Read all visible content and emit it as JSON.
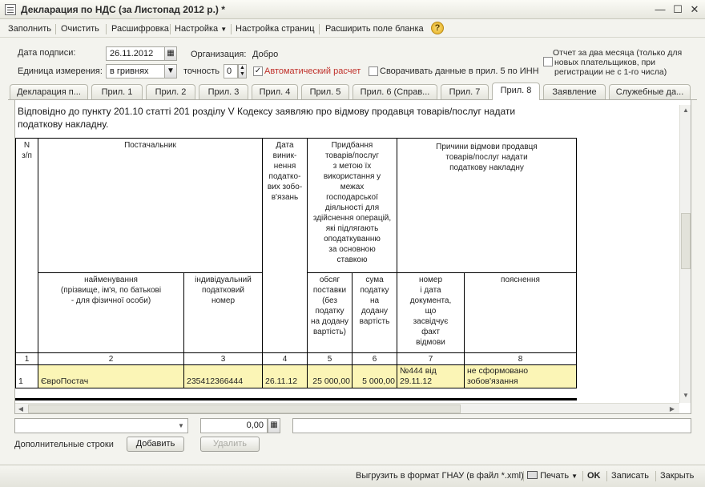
{
  "window": {
    "title": "Декларация по НДС (за Листопад 2012 р.) *"
  },
  "toolbar": {
    "fill": "Заполнить",
    "clear": "Очистить",
    "decode": "Расшифровка",
    "settings": "Настройка",
    "page_settings": "Настройка страниц",
    "expand_field": "Расширить поле бланка",
    "help": "?"
  },
  "form": {
    "sign_date_label": "Дата подписи:",
    "sign_date_value": "26.11.2012",
    "organization_label": "Организация:",
    "organization_value": "Добро",
    "unit_label": "Единица измерения:",
    "unit_value": "в гривнях",
    "precision_label": "точность",
    "precision_value": "0",
    "auto_calc_label": "Автоматический расчет",
    "auto_calc_checked": true,
    "collapse_label": "Сворачивать данные в прил. 5 по ИНН",
    "collapse_checked": false,
    "two_month_label_1": "Отчет за два месяца (только для",
    "two_month_label_2": "новых плательщиков, при",
    "two_month_label_3": "регистрации не с 1-го числа)",
    "two_month_checked": false
  },
  "tabs": [
    {
      "label": "Декларация п..."
    },
    {
      "label": "Прил. 1"
    },
    {
      "label": "Прил. 2"
    },
    {
      "label": "Прил. 3"
    },
    {
      "label": "Прил. 4"
    },
    {
      "label": "Прил. 5"
    },
    {
      "label": "Прил. 6 (Справ..."
    },
    {
      "label": "Прил. 7"
    },
    {
      "label": "Прил. 8"
    },
    {
      "label": "Заявление"
    },
    {
      "label": "Служебные да..."
    }
  ],
  "active_tab": "Прил. 8",
  "document": {
    "intro_line1": "Відповідно до пункту 201.10 статті 201 розділу V Кодексу заявляю про відмову продавця товарів/послуг надати",
    "intro_line2": "податкову накладну.",
    "headers": {
      "num": "N\nз/п",
      "supplier": "Постачальник",
      "date": "Дата\nвиник-\nнення\nподатко-\nвих зобо-\nв'язань",
      "purchase": "Придбання\nтоварів/послуг\nз метою їх\nвикористання у\nмежах\nгосподарської\nдіяльності для\nздійснення операцій,\nякі підлягають\nоподаткуванню\nза основною\nставкою",
      "reasons": "Причини відмови продавця\nтоварів/послуг надати\nподаткову накладну",
      "name": "найменування\n(прізвище, ім'я, по батькові\n- для фізичної особи)",
      "tax_number": "індивідуальний\nподатковий\nномер",
      "volume": "обсяг\nпоставки\n(без\nподатку\nна додану\nвартість)",
      "vat_sum": "сума\nподатку\nна\nдодану\nвартість",
      "doc_number": "номер\nі дата\nдокумента,\nщо\nзасвідчує\nфакт\nвідмови",
      "explanation": "пояснення"
    },
    "col_numbers": [
      "1",
      "2",
      "3",
      "4",
      "5",
      "6",
      "7",
      "8"
    ],
    "rows": [
      {
        "num": "1",
        "name": "ЄвроПостач",
        "tax_number": "235412366444",
        "date": "26.11.12",
        "volume": "25 000,00",
        "vat_sum": "5 000,00",
        "doc_number": "№444 від\n29.11.12",
        "explanation": "не сформовано\nзобов'язання"
      }
    ]
  },
  "bottom_form": {
    "amount_value": "0,00",
    "extra_rows_label": "Дополнительные строки",
    "add_button": "Добавить",
    "delete_button": "Удалить"
  },
  "status_bar": {
    "export": "Выгрузить в формат ГНАУ (в файл *.xml)",
    "print": "Печать",
    "ok": "OK",
    "save": "Записать",
    "close": "Закрыть"
  },
  "colors": {
    "highlight_row": "#fbf5b6",
    "auto_calc_text": "#c0312b"
  }
}
